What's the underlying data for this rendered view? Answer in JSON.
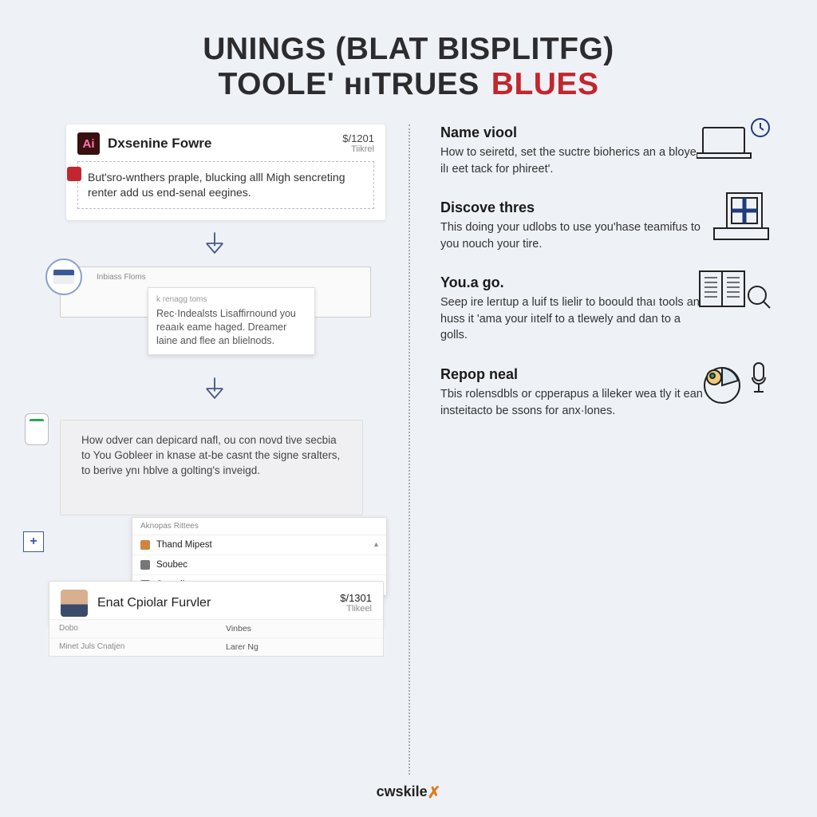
{
  "heading": {
    "line1": "UNINGS (BLAT BISPLITFG)",
    "line2a": "TOOLE' ʜıTRUES",
    "line2b": "BLUES"
  },
  "left": {
    "card1": {
      "badge": "Ai",
      "title": "Dxsenine Fowre",
      "price": "$/1201",
      "price_sub": "Tiikrel",
      "body": "But'sro-wnthers praple, blucking alll Migh sencreting renter add us end-senal eegines."
    },
    "card2": {
      "label": "Inbiass Floms",
      "tip_title": "k renagg toms",
      "tip_body": "Rec·Indealsts Lisaffirnound you reaaık eame haged. Dreamer laine and flee an blielnods."
    },
    "card3": {
      "main": "How odver can depicard nafl, ou con novd tive secbia to You Gobleer in knase at-be casnt the signe sralters, to berive ynı hblve a golting's inveigd.",
      "list_header": "Aknopas Rittees",
      "list": [
        "Thand Mipest",
        "Soubec",
        "Smaollo"
      ]
    },
    "profile": {
      "name": "Enat Cpiolar Furvler",
      "price": "$/1301",
      "price_sub": "Tlikeel"
    },
    "meta": {
      "k1": "Dobo",
      "v1": "Vinbes",
      "k2": "Minet Juls Cnatjen",
      "v2": "Larer Ng"
    }
  },
  "features": [
    {
      "title": "Name viool",
      "body": "How to seiretd, set the suctre bioherics an a bloye ilı eet tack for phireet'."
    },
    {
      "title": "Discove thres",
      "body": "This doing your udlobs to use you'hase teamifus to you nouch your tire."
    },
    {
      "title": "You.a go.",
      "body": "Seep ire lerıtup a luif ts lielir to boould thaı tools an huss it 'ama your iıtelf to a tlewely and dan to a golls."
    },
    {
      "title": "Repop neal",
      "body": "Tbis rolensdbls or cpperapus a lileker wea tly it ean insteitacto be ssons for anx·lones."
    }
  ],
  "footer": {
    "brand": "cwskile"
  }
}
